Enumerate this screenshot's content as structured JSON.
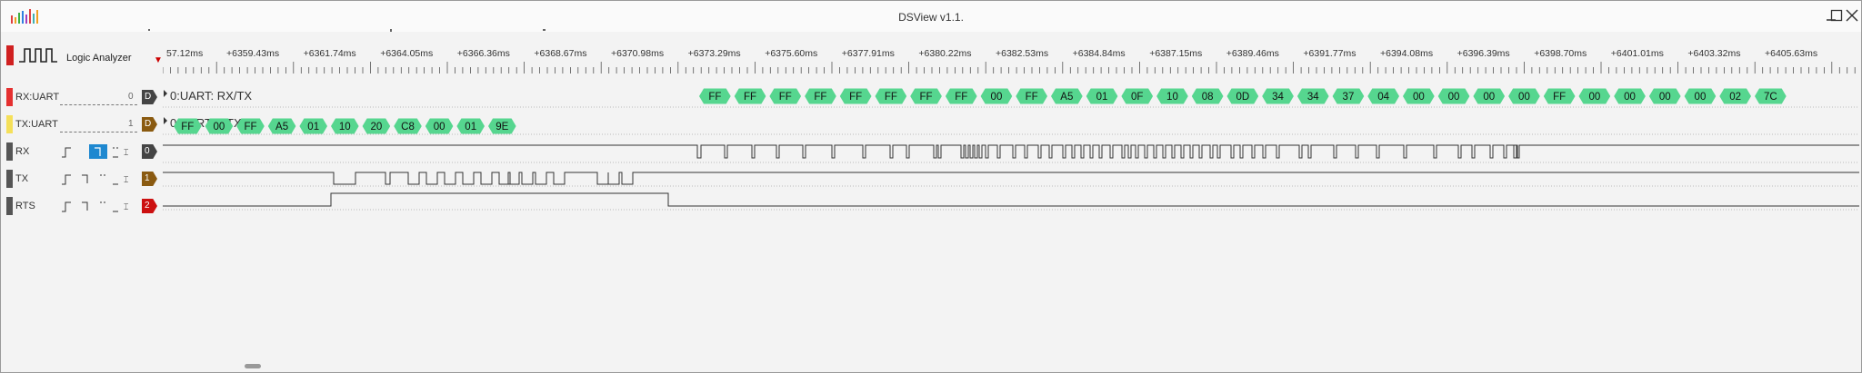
{
  "window": {
    "title": "DSView v1.1."
  },
  "device": {
    "label": "Logic Analyzer"
  },
  "ruler": {
    "first_label": "57.12ms",
    "labels": [
      "+6359.43ms",
      "+6361.74ms",
      "+6364.05ms",
      "+6366.36ms",
      "+6368.67ms",
      "+6370.98ms",
      "+6373.29ms",
      "+6375.60ms",
      "+6377.91ms",
      "+6380.22ms",
      "+6382.53ms",
      "+6384.84ms",
      "+6387.15ms",
      "+6389.46ms",
      "+6391.77ms",
      "+6394.08ms",
      "+6396.39ms",
      "+6398.70ms",
      "+6401.01ms",
      "+6403.32ms",
      "+6405.63ms"
    ]
  },
  "channels": [
    {
      "name": "RX:UART",
      "index": "0",
      "badge": "D",
      "color": "#e53030",
      "badge_color": "#444444",
      "kind": "decoder"
    },
    {
      "name": "TX:UART",
      "index": "1",
      "badge": "D",
      "color": "#f5e05a",
      "badge_color": "#8a5a10",
      "kind": "decoder"
    },
    {
      "name": "RX",
      "badge": "0",
      "color": "#555555",
      "badge_color": "#444444",
      "kind": "logic",
      "trigger_selected": "1"
    },
    {
      "name": "TX",
      "badge": "1",
      "color": "#555555",
      "badge_color": "#8a5a10",
      "kind": "logic"
    },
    {
      "name": "RTS",
      "badge": "2",
      "color": "#555555",
      "badge_color": "#cc1010",
      "kind": "logic"
    }
  ],
  "decoders": {
    "rx_title": "0:UART: RX/TX",
    "tx_title": "0:UART: ",
    "tx_title_hidden": "TX",
    "rx_bytes": [
      "FF",
      "FF",
      "FF",
      "FF",
      "FF",
      "FF",
      "FF",
      "FF",
      "00",
      "FF",
      "A5",
      "01",
      "0F",
      "10",
      "08",
      "0D",
      "34",
      "34",
      "37",
      "04",
      "00",
      "00",
      "00",
      "00",
      "FF",
      "00",
      "00",
      "00",
      "00",
      "02",
      "7C"
    ],
    "tx_bytes": [
      "FF",
      "00",
      "FF",
      "A5",
      "01",
      "10",
      "20",
      "C8",
      "00",
      "01",
      "9E"
    ],
    "pill_color": "#56d68f"
  }
}
